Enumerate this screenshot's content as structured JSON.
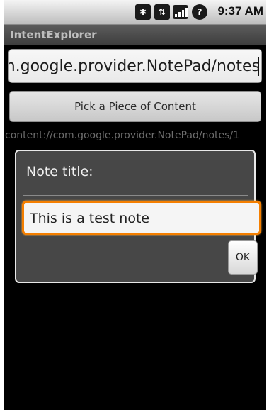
{
  "status_bar": {
    "time": "9:37 AM",
    "icons": [
      "bluetooth-icon",
      "data-transfer-icon",
      "signal-icon",
      "battery-unknown-icon"
    ]
  },
  "app": {
    "title": "IntentExplorer"
  },
  "url_field": {
    "value": "/com.google.provider.NotePad/notes"
  },
  "pick_button": {
    "label": "Pick a Piece of Content"
  },
  "result": {
    "text": "content://com.google.provider.NotePad/notes/1"
  },
  "dialog": {
    "title": "Note title:",
    "input_value": "This is a test note",
    "ok_label": "OK"
  },
  "colors": {
    "focus_border": "#f57f00",
    "dialog_bg": "#474747",
    "background": "#000000"
  }
}
